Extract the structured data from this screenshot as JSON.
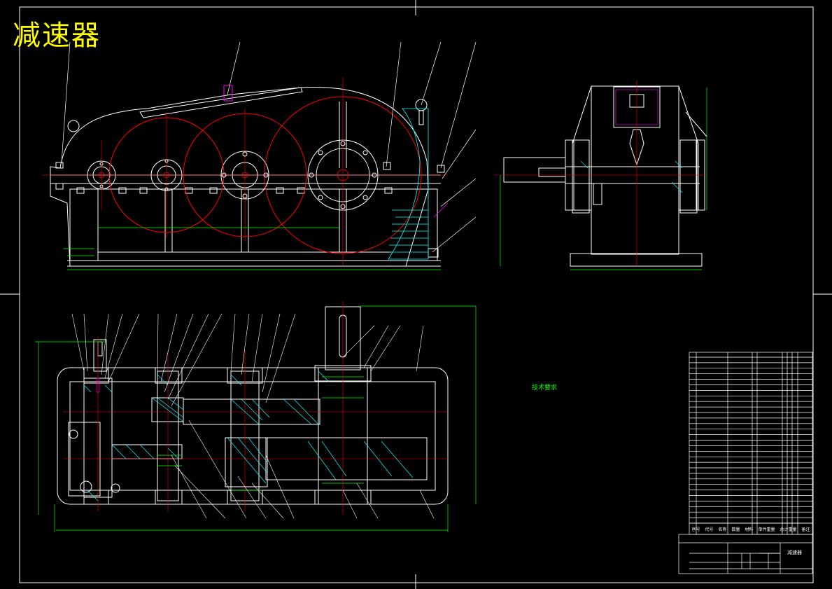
{
  "header": {
    "drawing_title": "减速器"
  },
  "tech_requirements": {
    "title": "技术要求"
  },
  "title_block": {
    "name": "减速器",
    "columns": [
      "序号",
      "代号",
      "名称",
      "数量",
      "材料",
      "单件重量",
      "总计重量",
      "备注"
    ]
  },
  "colors": {
    "background": "#000000",
    "outline": "#ffffff",
    "gear_circles": "#ff0000",
    "dimensions": "#00ff00",
    "title": "#ffff00",
    "hatch": "#00ffff",
    "accent": "#ff00ff"
  }
}
